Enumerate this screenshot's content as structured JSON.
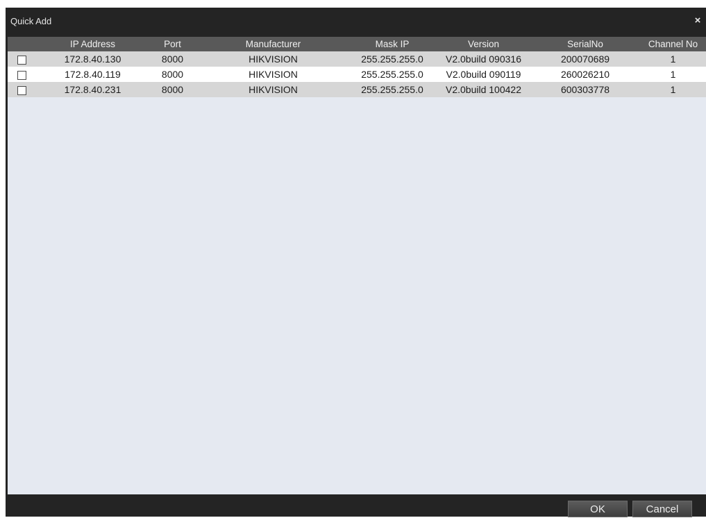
{
  "dialog": {
    "title": "Quick Add",
    "close_glyph": "×"
  },
  "table": {
    "headers": [
      "",
      "IP Address",
      "Port",
      "Manufacturer",
      "Mask IP",
      "Version",
      "SerialNo",
      "Channel No"
    ],
    "rows": [
      {
        "ip": "172.8.40.130",
        "port": "8000",
        "manufacturer": "HIKVISION",
        "mask": "255.255.255.0",
        "version": "V2.0build 090316",
        "serial": "200070689",
        "channel": "1",
        "checked": false
      },
      {
        "ip": "172.8.40.119",
        "port": "8000",
        "manufacturer": "HIKVISION",
        "mask": "255.255.255.0",
        "version": "V2.0build 090119",
        "serial": "260026210",
        "channel": "1",
        "checked": false
      },
      {
        "ip": "172.8.40.231",
        "port": "8000",
        "manufacturer": "HIKVISION",
        "mask": "255.255.255.0",
        "version": "V2.0build 100422",
        "serial": "600303778",
        "channel": "1",
        "checked": false
      }
    ]
  },
  "footer": {
    "ok_label": "OK",
    "cancel_label": "Cancel"
  },
  "colors": {
    "frame": "#242424",
    "header": "#595959",
    "row_alt": "#d6d6d6",
    "row": "#ffffff",
    "empty_area": "#e5e9f1"
  }
}
